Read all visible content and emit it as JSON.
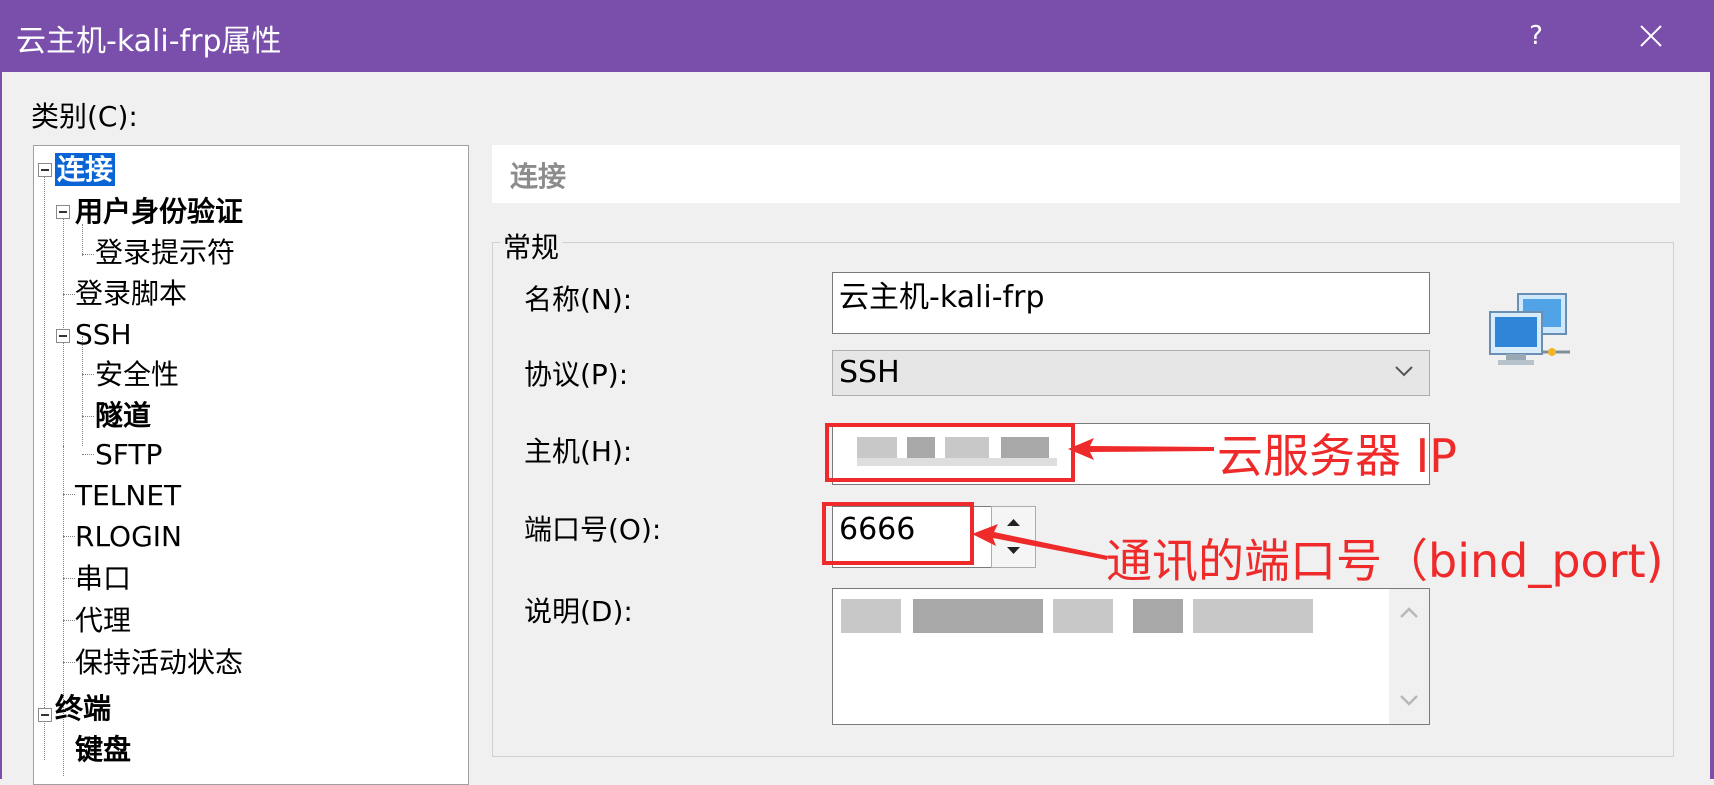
{
  "window": {
    "title": "云主机-kali-frp属性",
    "help_label": "?",
    "close_icon": "close-icon",
    "title_bar_color": "#7a4eab"
  },
  "category_label": "类别(C):",
  "tree": {
    "items": [
      {
        "label": "连接",
        "bold": true,
        "selected": true,
        "expander": "minus"
      },
      {
        "label": "用户身份验证",
        "bold": true,
        "expander": "minus"
      },
      {
        "label": "登录提示符",
        "bold": false
      },
      {
        "label": "登录脚本",
        "bold": false
      },
      {
        "label": "SSH",
        "bold": false,
        "expander": "minus"
      },
      {
        "label": "安全性",
        "bold": false
      },
      {
        "label": "隧道",
        "bold": true
      },
      {
        "label": "SFTP",
        "bold": false
      },
      {
        "label": "TELNET",
        "bold": false
      },
      {
        "label": "RLOGIN",
        "bold": false
      },
      {
        "label": "串口",
        "bold": false
      },
      {
        "label": "代理",
        "bold": false
      },
      {
        "label": "保持活动状态",
        "bold": false
      },
      {
        "label": "终端",
        "bold": true,
        "expander": "minus"
      },
      {
        "label": "键盘",
        "bold": true
      }
    ],
    "selected_color": "#0a64d6"
  },
  "panel": {
    "header": "连接",
    "group_title": "常规",
    "name": {
      "label": "名称(N):",
      "value": "云主机-kali-frp"
    },
    "protocol": {
      "label": "协议(P):",
      "value": "SSH"
    },
    "host": {
      "label": "主机(H):"
    },
    "port": {
      "label": "端口号(O):",
      "value": "6666"
    },
    "description": {
      "label": "说明(D):"
    },
    "icon": "network-computers-icon"
  },
  "annotations": {
    "host_note": "云服务器 IP",
    "port_note": "通讯的端口号（bind_port)",
    "color": "#ef2a2a"
  }
}
